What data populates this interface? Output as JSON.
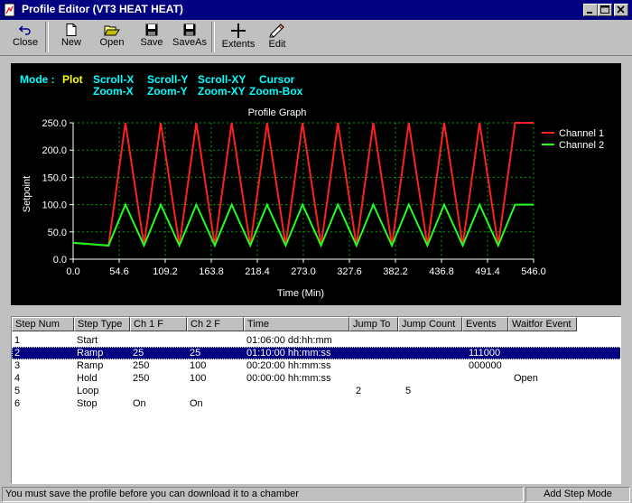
{
  "window": {
    "title": "Profile Editor (VT3 HEAT HEAT)"
  },
  "toolbar": {
    "items": [
      {
        "label": "Close",
        "icon": "undo-arrow-icon"
      },
      {
        "label": "New",
        "icon": "new-file-icon"
      },
      {
        "label": "Open",
        "icon": "open-folder-icon"
      },
      {
        "label": "Save",
        "icon": "floppy-disk-icon"
      },
      {
        "label": "SaveAs",
        "icon": "floppy-disk-icon"
      },
      {
        "label": "Extents",
        "icon": "crosshair-icon"
      },
      {
        "label": "Edit",
        "icon": "pencil-hand-icon"
      }
    ]
  },
  "mode": {
    "label": "Mode :",
    "active": "Plot",
    "scroll_x": "Scroll-X",
    "zoom_x": "Zoom-X",
    "scroll_y": "Scroll-Y",
    "zoom_y": "Zoom-Y",
    "scroll_xy": "Scroll-XY",
    "zoom_xy": "Zoom-XY",
    "cursor": "Cursor",
    "zoom_box": "Zoom-Box",
    "label_color": "#00ffff",
    "active_color": "#ffff00"
  },
  "chart_data": {
    "type": "line",
    "title": "Profile Graph",
    "xlabel": "Time (Min)",
    "ylabel": "Setpoint",
    "x_ticks": [
      "0.0",
      "54.6",
      "109.2",
      "163.8",
      "218.4",
      "273.0",
      "327.6",
      "382.2",
      "436.8",
      "491.4",
      "546.0"
    ],
    "y_ticks": [
      "0.0",
      "50.0",
      "100.0",
      "150.0",
      "200.0",
      "250.0"
    ],
    "xlim": [
      0,
      546
    ],
    "ylim": [
      0,
      250
    ],
    "grid": true,
    "legend_position": "top-right",
    "series": [
      {
        "name": "Channel 1",
        "color": "#ff2020",
        "x": [
          0,
          42,
          42,
          62,
          62,
          84,
          84,
          104,
          104,
          126,
          126,
          146,
          146,
          168,
          168,
          188,
          188,
          210,
          210,
          230,
          230,
          252,
          252,
          272,
          272,
          294,
          294,
          314,
          314,
          336,
          336,
          356,
          356,
          378,
          378,
          398,
          398,
          420,
          420,
          440,
          440,
          462,
          462,
          482,
          482,
          504,
          504,
          524,
          524,
          546
        ],
        "y": [
          30,
          25,
          25,
          250,
          250,
          25,
          25,
          250,
          250,
          25,
          25,
          250,
          250,
          25,
          25,
          250,
          250,
          25,
          25,
          250,
          250,
          25,
          25,
          250,
          250,
          25,
          25,
          250,
          250,
          25,
          25,
          250,
          250,
          25,
          25,
          250,
          250,
          25,
          25,
          250,
          250,
          25,
          25,
          250,
          250,
          25,
          25,
          250,
          250,
          250
        ]
      },
      {
        "name": "Channel 2",
        "color": "#20ff20",
        "x": [
          0,
          42,
          42,
          62,
          62,
          84,
          84,
          104,
          104,
          126,
          126,
          146,
          146,
          168,
          168,
          188,
          188,
          210,
          210,
          230,
          230,
          252,
          252,
          272,
          272,
          294,
          294,
          314,
          314,
          336,
          336,
          356,
          356,
          378,
          378,
          398,
          398,
          420,
          420,
          440,
          440,
          462,
          462,
          482,
          482,
          504,
          504,
          524,
          524,
          546
        ],
        "y": [
          30,
          25,
          25,
          100,
          100,
          25,
          25,
          100,
          100,
          25,
          25,
          100,
          100,
          25,
          25,
          100,
          100,
          25,
          25,
          100,
          100,
          25,
          25,
          100,
          100,
          25,
          25,
          100,
          100,
          25,
          25,
          100,
          100,
          25,
          25,
          100,
          100,
          25,
          25,
          100,
          100,
          25,
          25,
          100,
          100,
          25,
          25,
          100,
          100,
          100
        ]
      }
    ]
  },
  "steps": {
    "columns": [
      "Step Num",
      "Step Type",
      "Ch 1 F",
      "Ch 2 F",
      "Time",
      "Jump To",
      "Jump Count",
      "Events",
      "Waitfor Event"
    ],
    "rows": [
      {
        "num": "1",
        "type": "Start",
        "ch1": "",
        "ch2": "",
        "time": "01:06:00 dd:hh:mm",
        "jump_to": "",
        "jump_count": "",
        "events": "",
        "waitfor": ""
      },
      {
        "num": "2",
        "type": "Ramp",
        "ch1": "25",
        "ch2": "25",
        "time": "01:10:00 hh:mm:ss",
        "jump_to": "",
        "jump_count": "",
        "events": "111000",
        "waitfor": ""
      },
      {
        "num": "3",
        "type": "Ramp",
        "ch1": "250",
        "ch2": "100",
        "time": "00:20:00 hh:mm:ss",
        "jump_to": "",
        "jump_count": "",
        "events": "000000",
        "waitfor": ""
      },
      {
        "num": "4",
        "type": "Hold",
        "ch1": "250",
        "ch2": "100",
        "time": "00:00:00 hh:mm:ss",
        "jump_to": "",
        "jump_count": "",
        "events": "",
        "waitfor": "Open"
      },
      {
        "num": "5",
        "type": "Loop",
        "ch1": "",
        "ch2": "",
        "time": "",
        "jump_to": "2",
        "jump_count": "5",
        "events": "",
        "waitfor": ""
      },
      {
        "num": "6",
        "type": "Stop",
        "ch1": "On",
        "ch2": "On",
        "time": "",
        "jump_to": "",
        "jump_count": "",
        "events": "",
        "waitfor": ""
      }
    ],
    "selected_index": 1
  },
  "status": {
    "message": "You must save the profile before you can download it to a chamber",
    "mode": "Add Step Mode"
  }
}
